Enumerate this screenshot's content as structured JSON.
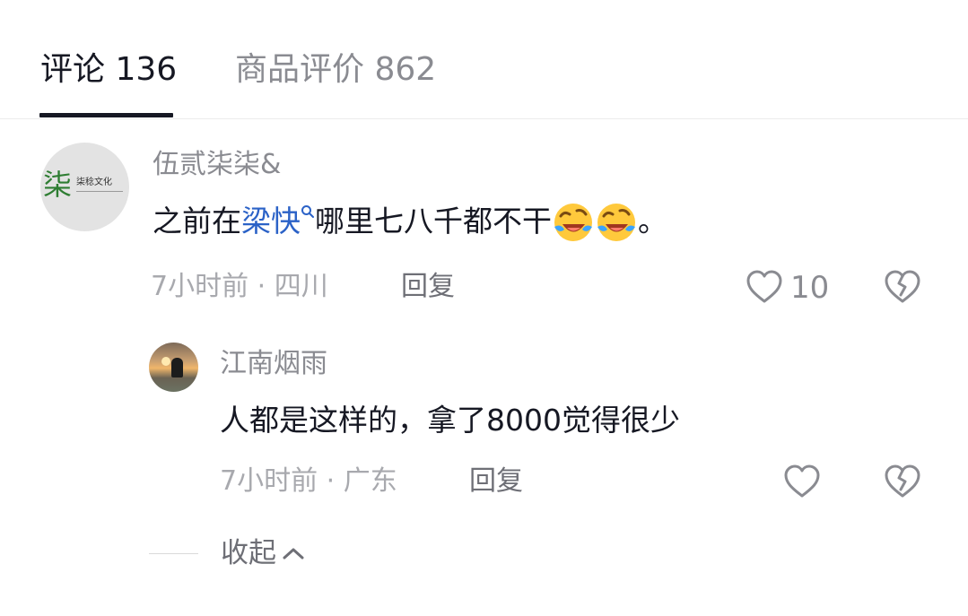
{
  "tabs": [
    {
      "label": "评论 136",
      "active": true
    },
    {
      "label": "商品评价 862",
      "active": false
    }
  ],
  "comment": {
    "avatar_char": "柒",
    "avatar_text": "柒稔文化",
    "username": "伍贰柒柒&",
    "text_before": "之前在",
    "link_text": "梁快",
    "text_after": "哪里七八千都不干",
    "text_end": "。",
    "time": "7小时前",
    "location": "四川",
    "reply_label": "回复",
    "likes": "10"
  },
  "reply": {
    "username": "江南烟雨",
    "text": "人都是这样的，拿了8000觉得很少",
    "time": "7小时前",
    "location": "广东",
    "reply_label": "回复"
  },
  "collapse_label": "收起",
  "colors": {
    "link": "#2b62c7",
    "text_primary": "#161823",
    "text_secondary": "#8a8b91",
    "meta": "#a8a9ae"
  }
}
